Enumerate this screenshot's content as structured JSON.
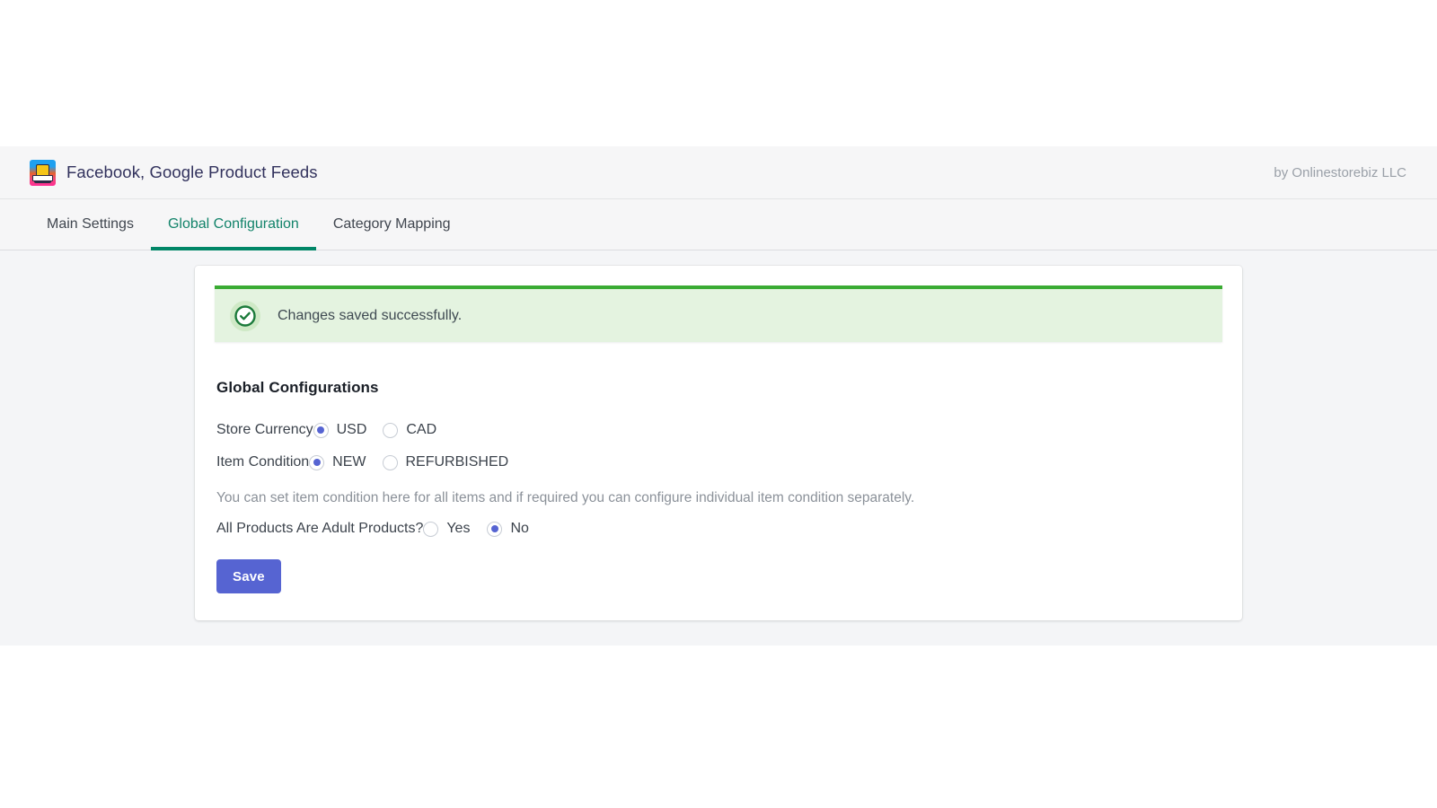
{
  "header": {
    "app_icon_name": "storefront-icon",
    "app_name": "Facebook, Google Product Feeds",
    "vendor": "by Onlinestorebiz LLC"
  },
  "tabs": [
    {
      "label": "Main Settings",
      "active": false
    },
    {
      "label": "Global Configuration",
      "active": true
    },
    {
      "label": "Category Mapping",
      "active": false
    }
  ],
  "banner": {
    "icon_name": "check-circle-icon",
    "message": "Changes saved successfully.",
    "accent_color": "#3aab33",
    "background_color": "#e4f3e0"
  },
  "form": {
    "heading": "Global Configurations",
    "fields": [
      {
        "label": "Store Currency",
        "options": [
          {
            "label": "USD",
            "selected": true
          },
          {
            "label": "CAD",
            "selected": false
          }
        ]
      },
      {
        "label": "Item Condition",
        "options": [
          {
            "label": "NEW",
            "selected": true
          },
          {
            "label": "REFURBISHED",
            "selected": false
          }
        ]
      },
      {
        "label": "All Products Are Adult Products?",
        "options": [
          {
            "label": "Yes",
            "selected": false
          },
          {
            "label": "No",
            "selected": true
          }
        ]
      }
    ],
    "helper_text": "You can set item condition here for all items and if required you can configure individual item condition separately.",
    "save_label": "Save",
    "save_color": "#5664d2"
  },
  "theme": {
    "active_tab_color": "#12836a",
    "active_tab_underline": "#018667",
    "page_background": "#f4f5f7",
    "card_background": "#ffffff"
  }
}
